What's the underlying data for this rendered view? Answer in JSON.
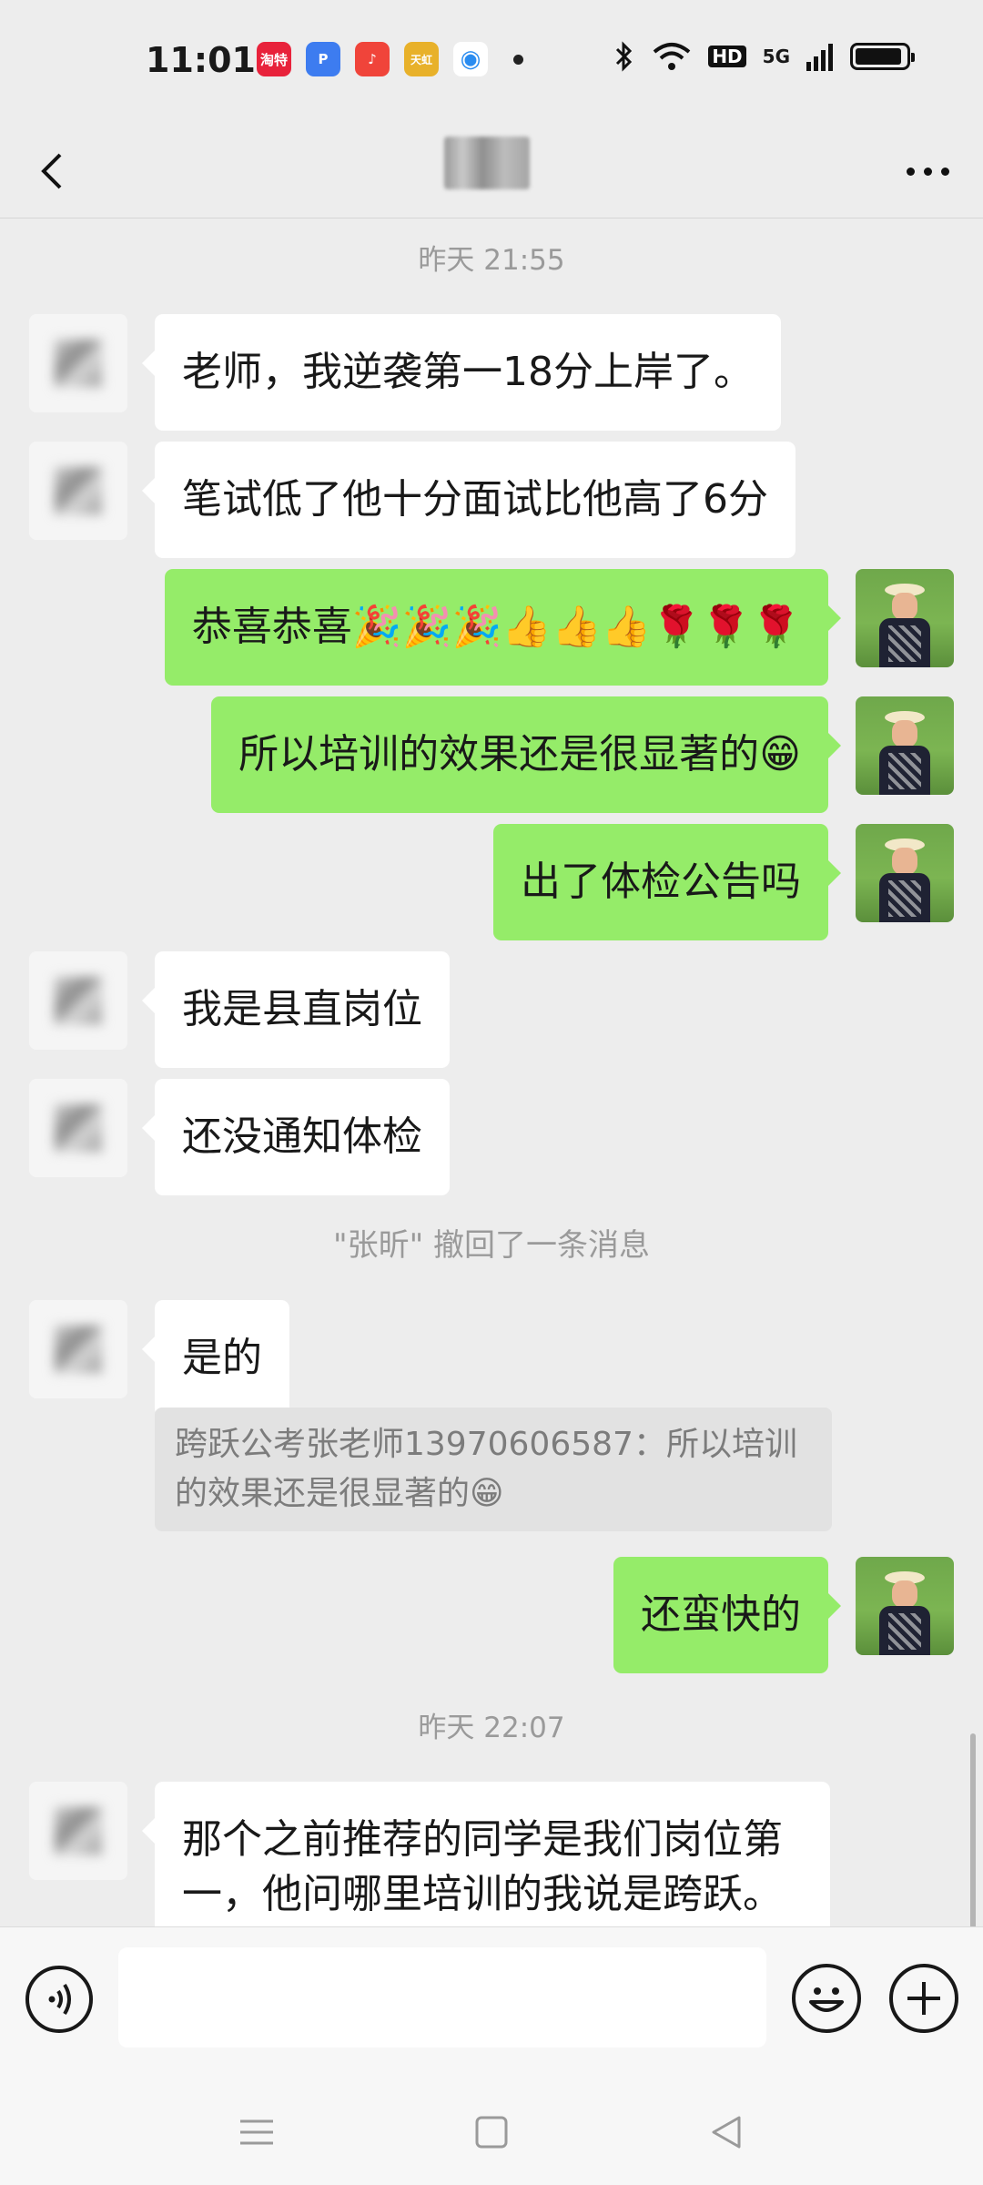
{
  "status_bar": {
    "time": "11:01",
    "app_icons": [
      {
        "name": "taote-app-icon",
        "label": "淘特",
        "color": "#e8223b"
      },
      {
        "name": "pdd-app-icon",
        "label": "P",
        "color": "#3d7cf0"
      },
      {
        "name": "music-app-icon",
        "label": "♪",
        "color": "#f0443a"
      },
      {
        "name": "tianhong-app-icon",
        "label": "天虹",
        "color": "#e8b12a"
      },
      {
        "name": "browser-app-icon",
        "label": "◉",
        "color": "#ffffff"
      }
    ],
    "network_labels": {
      "hd": "HD",
      "signal": "5G"
    },
    "battery_level": 0.92
  },
  "nav": {
    "back_icon": "chevron-left-icon",
    "more_icon": "more-dots-icon"
  },
  "timestamps": {
    "first": "昨天 21:55",
    "second": "昨天 22:07"
  },
  "system_notice": "\"张昕\" 撤回了一条消息",
  "messages": [
    {
      "side": "other",
      "text": "老师，我逆袭第一18分上岸了。"
    },
    {
      "side": "other",
      "text": "笔试低了他十分面试比他高了6分"
    },
    {
      "side": "self",
      "text": "恭喜恭喜🎉🎉🎉👍👍👍🌹🌹🌹"
    },
    {
      "side": "self",
      "text": "所以培训的效果还是很显著的😁"
    },
    {
      "side": "self",
      "text": "出了体检公告吗"
    },
    {
      "side": "other",
      "text": "我是县直岗位"
    },
    {
      "side": "other",
      "text": "还没通知体检"
    },
    {
      "side": "other",
      "text": "是的"
    },
    {
      "side": "self",
      "text": "还蛮快的"
    },
    {
      "side": "other",
      "text": "那个之前推荐的同学是我们岗位第一，他问哪里培训的我说是跨跃。"
    }
  ],
  "quote": {
    "text": "跨跃公考张老师13970606587：所以培训的效果还是很显著的😁"
  },
  "input_bar": {
    "voice_icon": "voice-icon",
    "emoji_icon": "emoji-icon",
    "add_icon": "plus-icon",
    "input_value": ""
  },
  "system_nav": {
    "menu_icon": "menu-icon",
    "home_icon": "home-icon",
    "back_icon": "back-triangle-icon"
  },
  "colors": {
    "background": "#ededed",
    "self_bubble": "#95ec69",
    "other_bubble": "#ffffff"
  }
}
